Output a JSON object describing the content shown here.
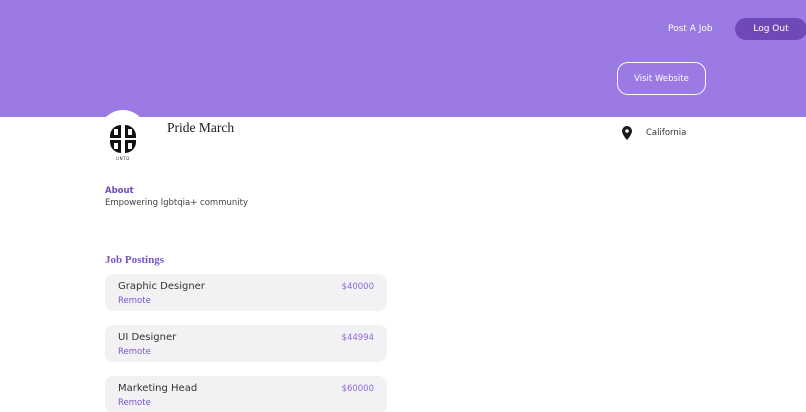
{
  "header": {
    "post_job_label": "Post A Job",
    "logout_label": "Log Out",
    "visit_website_label": "Visit Website"
  },
  "profile": {
    "org_name": "Pride March",
    "logo_text": "UNTD",
    "location": "California",
    "about_title": "About",
    "about_text": "Empowering lgbtqia+ community"
  },
  "jobs": {
    "title": "Job Postings",
    "items": [
      {
        "title": "Graphic Designer",
        "location": "Remote",
        "salary": "$40000"
      },
      {
        "title": "UI Designer",
        "location": "Remote",
        "salary": "$44994"
      },
      {
        "title": "Marketing Head",
        "location": "Remote",
        "salary": "$60000"
      }
    ]
  },
  "colors": {
    "header_bg": "#9b7ae4",
    "accent": "#6f49b8",
    "card_bg": "#f2f2f4"
  }
}
